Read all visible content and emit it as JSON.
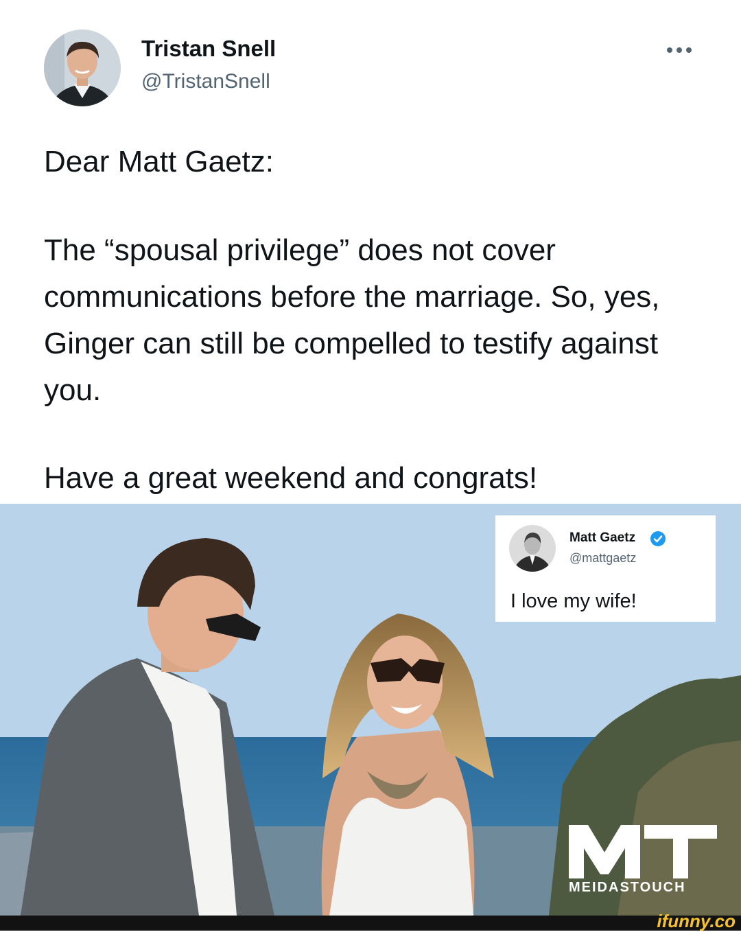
{
  "tweet": {
    "author_name": "Tristan Snell",
    "author_handle": "@TristanSnell",
    "more_icon": "more-horizontal-icon",
    "text_paragraphs": [
      "Dear Matt Gaetz:",
      "The “spousal privilege” does not cover communications before the marriage. So, yes, Ginger can still be compelled to testify against you.",
      "Have a great weekend and congrats!"
    ]
  },
  "embedded_tweet": {
    "author_name": "Matt Gaetz",
    "author_handle": "@mattgaetz",
    "verified_icon": "verified-badge-icon",
    "text": "I love my wife!"
  },
  "watermarks": {
    "logo_letters": "MT",
    "logo_text": "MEIDASTOUCH",
    "site": "ifunny.co"
  },
  "colors": {
    "verified_blue": "#1d9bf0",
    "text_primary": "#0f1419",
    "text_secondary": "#536471",
    "ifunny_yellow": "#f6c12a"
  }
}
